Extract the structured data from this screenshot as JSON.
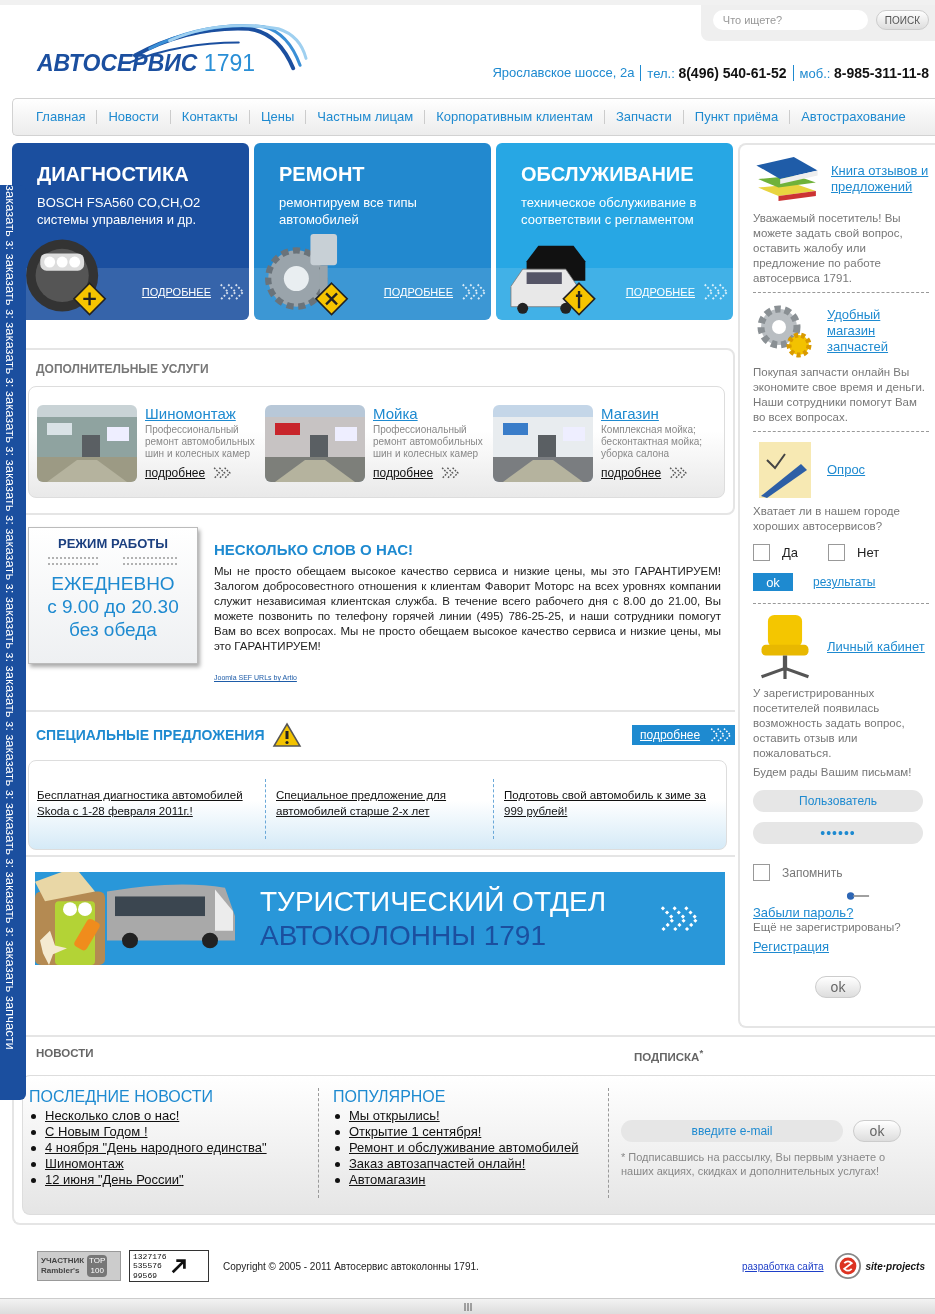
{
  "header": {
    "logo_text": "АВТОСЕРВИС",
    "logo_number": "1791",
    "search": {
      "placeholder": "Что ищете?",
      "button": "ПОИСК"
    },
    "contacts": [
      "Ярославское шоссе, 2а",
      "тел.: **8(496) 540-61-52**",
      "моб.: **8-985-311-11-8**"
    ]
  },
  "nav": [
    "Главная",
    "Новости",
    "Контакты",
    "Цены",
    "Частным лицам",
    "Корпоративным клиентам",
    "Запчасти",
    "Пункт приёма",
    "Автострахование"
  ],
  "side_tab": "заказать з: заказать з: заказать з: заказать з: заказать з: заказать з: заказать з: заказать з: заказать з: заказать з: заказать з: заказать запчасти",
  "services": [
    {
      "kind": "diagnostics",
      "color": "#1b4f9f",
      "title": "ДИАГНОСТИКА",
      "lines": [
        "BOSCH FSA560 CO,CH,O2",
        "системы управления и др."
      ],
      "link": "ПОДРОБНЕЕ"
    },
    {
      "kind": "repair",
      "color": "#2289cf",
      "title": "РЕМОНТ",
      "lines": [
        "ремонтируем все типы",
        "автомобилей"
      ],
      "link": "ПОДРОБНЕЕ"
    },
    {
      "kind": "maintenance",
      "color": "#27a7e4",
      "title": "ОБСЛУЖИВАНИЕ",
      "lines": [
        "техническое обслуживание в",
        "соответствии с регламентом"
      ],
      "link": "ПОДРОБНЕЕ"
    }
  ],
  "additional": {
    "title": "ДОПОЛНИТЕЛЬНЫЕ УСЛУГИ",
    "items": [
      {
        "kind": "picture",
        "title": "Шиномонтаж",
        "text": "Профессиональный ремонт автомобильных шин и колесных камер",
        "link": "подробнее"
      },
      {
        "kind": "picture",
        "title": "Мойка",
        "text": "Профессиональный ремонт автомобильных шин и колесных камер",
        "link": "подробнее"
      },
      {
        "kind": "picture",
        "title": "Магазин",
        "text": "Комплексная мойка; бесконтактная мойка; уборка салона",
        "link": "подробнее"
      }
    ]
  },
  "schedule": {
    "title": "РЕЖИМ РАБОТЫ",
    "lines": [
      "ЕЖЕДНЕВНО",
      "с 9.00 до 20.30",
      "без обеда"
    ]
  },
  "about": {
    "title": "НЕСКОЛЬКО СЛОВ О НАС!",
    "text": "Мы не просто обещаем высокое качество сервиса и низкие цены, мы это ГАРАНТИРУЕМ! Залогом добросовестного отношения к клиентам Фаворит Моторс на всех уровнях компании служит независимая клиентская служба. В течение всего рабочего дня с 8.00 до 21.00, Вы можете позвонить по телефону горячей линии (495) 786-25-25, и наши сотрудники помогут Вам во всех вопросах. Мы не просто обещаем высокое качество сервиса и низкие цены, мы это ГАРАНТИРУЕМ!",
    "credit": "Joomla SEF URLs by Artio"
  },
  "offers": {
    "title": "СПЕЦИАЛЬНЫЕ ПРЕДЛОЖЕНИЯ",
    "more": "подробнее",
    "items": [
      "Бесплатная диагностика автомобилей Skoda с 1-28 февраля 2011г.!",
      "Специальное предложение для автомобилей старше 2-х лет",
      "Подготовь свой автомобиль к зиме за 999 рублей!"
    ]
  },
  "tour_banner": {
    "line1": "ТУРИСТИЧЕСКИЙ ОТДЕЛ",
    "line2": "АВТОКОЛОННЫ 1791"
  },
  "sidebar": {
    "reviews": {
      "title": "Книга отзывов и предложений",
      "text": "Уважаемый посетитель! Вы можете задать свой вопрос, оставить жалобу или предложение по работе автосервиса 1791."
    },
    "shop": {
      "title": "Удобный магазин запчастей",
      "text": "Покупая запчасти онлайн Вы экономите свое время и деньги. Наши сотрудники помогут Вам во всех вопросах."
    },
    "poll": {
      "title": "Опрос",
      "question": "Хватает ли в нашем городе хороших автосервисов?",
      "options": [
        {
          "label": "Да",
          "checked": false
        },
        {
          "label": "Нет",
          "checked": false
        }
      ],
      "submit": "ok",
      "results": "результаты"
    },
    "cabinet": {
      "title": "Личный кабинет",
      "text": "У зарегистрированных посетителей появилась возможность задать вопрос, оставить отзыв или пожаловаться.",
      "text2": "Будем рады Вашим письмам!",
      "username": {
        "placeholder": "Пользователь"
      },
      "password": {
        "value": "••••••"
      },
      "remember": {
        "label": "Запомнить",
        "checked": false
      },
      "forgot": "Забыли пароль?",
      "not_registered": "Ещё не зарегистрированы?",
      "register": "Регистрация",
      "submit": "ok"
    }
  },
  "news": {
    "heading": "НОВОСТИ",
    "columns": [
      {
        "title": "ПОСЛЕДНИЕ НОВОСТИ",
        "items": [
          "Несколько слов о нас!",
          "С Новым Годом !",
          "4 ноября \"День народного единства\"",
          "Шиномонтаж",
          "12 июня \"День России\""
        ]
      },
      {
        "title": "ПОПУЛЯРНОЕ",
        "items": [
          "Мы открылись!",
          "Открытие 1 сентября!",
          "Ремонт и обслуживание автомобилей",
          "Заказ автозапчастей онлайн!",
          "Автомагазин"
        ]
      }
    ]
  },
  "subscribe": {
    "heading": "ПОДПИСКА$^{*}$",
    "placeholder": "введите e-mail",
    "button": "ok",
    "note": "* Подписавшись на рассылку, Вы первым узнаете о наших акциях, скидках и дополнительных услугах!"
  },
  "footer": {
    "rambler": [
      "УЧАСТНИК",
      "Rambler's",
      "TOP",
      "100"
    ],
    "counter": [
      "1327176",
      "535576",
      "99569"
    ],
    "copyright": "Copyright © 2005 - 2011 Автосервис автоколонны 1791.",
    "dev_link": "разработка сайта",
    "dev_logo": "site·projects"
  }
}
